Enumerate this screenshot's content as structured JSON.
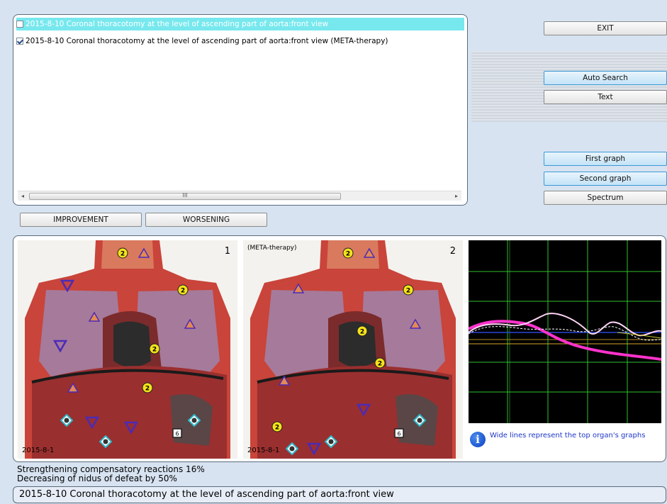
{
  "list": {
    "items": [
      {
        "checked": false,
        "selected": true,
        "text": "2015-8-10  Coronal thoracotomy at the level of ascending part of aorta:front view"
      },
      {
        "checked": true,
        "selected": false,
        "text": "2015-8-10  Coronal thoracotomy at the level of ascending part of aorta:front view  (META-therapy)"
      }
    ],
    "scroll_thumb_label": "III"
  },
  "buttons": {
    "exit": "EXIT",
    "auto_search": "Auto Search",
    "text": "Text",
    "first_graph": "First graph",
    "second_graph": "Second graph",
    "spectrum": "Spectrum",
    "improvement": "IMPROVEMENT",
    "worsening": "WORSENING"
  },
  "images": [
    {
      "number": "1",
      "tag": "",
      "date": "2015-8-1"
    },
    {
      "number": "2",
      "tag": "(META-therapy)",
      "date": "2015-8-1"
    }
  ],
  "graph_info": {
    "icon": "info-icon",
    "text": "Wide lines represent the top organ's graphs"
  },
  "status": {
    "line1": "Strengthening compensatory reactions 16%",
    "line2": "Decreasing of nidus of defeat by 50%",
    "bar": "2015-8-10 Coronal thoracotomy at the level of ascending part of aorta:front view"
  },
  "colors": {
    "background": "#d7e3f1",
    "selected_row": "#77e8ee",
    "graph_grid": "#2fbf2f",
    "graph_pink": "#ff33cc",
    "info_text": "#1f37c8"
  }
}
